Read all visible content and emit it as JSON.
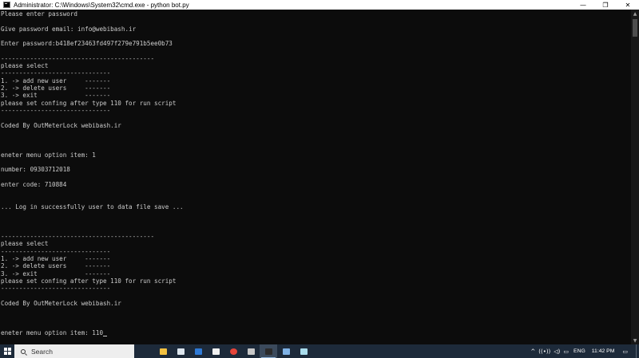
{
  "window": {
    "title": "Administrator: C:\\Windows\\System32\\cmd.exe - python  bot.py",
    "controls": {
      "minimize": "—",
      "maximize": "❐",
      "close": "✕"
    }
  },
  "console": {
    "lines": [
      {
        "row": 0,
        "text": "Please enter password"
      },
      {
        "row": 2,
        "text": "Give password email: info@webibash.ir"
      },
      {
        "row": 4,
        "text": "Enter password:b418ef23463fd497f279e791b5ee0b73"
      },
      {
        "row": 6,
        "text": "------------------------------------------"
      },
      {
        "row": 7,
        "text": "please select"
      },
      {
        "row": 8,
        "text": "------------------------------"
      },
      {
        "row": 9,
        "text": "1. -> add new user     -------"
      },
      {
        "row": 10,
        "text": "2. -> delete users     -------"
      },
      {
        "row": 11,
        "text": "3. -> exit             -------"
      },
      {
        "row": 12,
        "text": "please set confing after type 110 for run script"
      },
      {
        "row": 13,
        "text": "------------------------------"
      },
      {
        "row": 15,
        "text": "Coded By OutMeterLock webibash.ir"
      },
      {
        "row": 19,
        "text": "eneter menu option item: 1"
      },
      {
        "row": 21,
        "text": "number: 09303712018"
      },
      {
        "row": 23,
        "text": "enter code: 710884"
      },
      {
        "row": 26,
        "text": "... Log in successfully user to data file save ..."
      },
      {
        "row": 30,
        "text": "------------------------------------------"
      },
      {
        "row": 31,
        "text": "please select"
      },
      {
        "row": 32,
        "text": "------------------------------"
      },
      {
        "row": 33,
        "text": "1. -> add new user     -------"
      },
      {
        "row": 34,
        "text": "2. -> delete users     -------"
      },
      {
        "row": 35,
        "text": "3. -> exit             -------"
      },
      {
        "row": 36,
        "text": "please set confing after type 110 for run script"
      },
      {
        "row": 37,
        "text": "------------------------------"
      },
      {
        "row": 39,
        "text": "Coded By OutMeterLock webibash.ir"
      },
      {
        "row": 43,
        "text": "eneter menu option item: 110",
        "cursor": true
      }
    ]
  },
  "taskbar": {
    "search_label": "Search",
    "apps": [
      {
        "name": "file-explorer",
        "color": "#f3c141",
        "active": false
      },
      {
        "name": "microsoft-store",
        "color": "#dde6ee",
        "active": false
      },
      {
        "name": "outlook",
        "color": "#2f7ad6",
        "active": false
      },
      {
        "name": "paint",
        "color": "#f0f0f0",
        "active": false
      },
      {
        "name": "chrome",
        "color": "#e5453a",
        "active": false
      },
      {
        "name": "task-manager",
        "color": "#c8c8c8",
        "active": false
      },
      {
        "name": "command-prompt",
        "color": "#2b2b2b",
        "active": true
      },
      {
        "name": "snipping-tool",
        "color": "#7fb2e5",
        "active": false
      },
      {
        "name": "notepad",
        "color": "#a9dcec",
        "active": false
      }
    ],
    "tray": {
      "expand": "^",
      "icons": [
        "wifi-icon",
        "speaker-icon",
        "battery-icon"
      ],
      "language": "ENG",
      "time": "11:42 PM",
      "notifications": "notification-icon"
    }
  }
}
